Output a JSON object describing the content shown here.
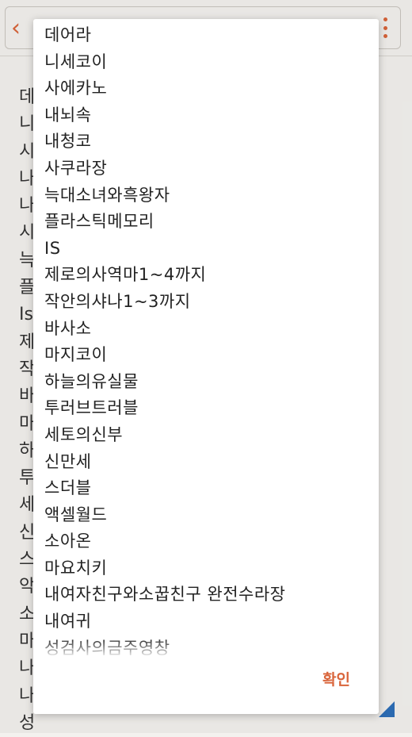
{
  "background": {
    "peek_lines": [
      "데",
      "니",
      "시",
      "나",
      "나",
      "시",
      "늑",
      "플",
      "Is",
      "제",
      "작",
      "바",
      "마",
      "하",
      "투",
      "세",
      "신",
      "스",
      "악",
      "소",
      "마",
      "나",
      "나",
      "성"
    ]
  },
  "dialog": {
    "items": [
      "데어라",
      "니세코이",
      "사에카노",
      "내뇌속",
      "내청코",
      "사쿠라장",
      "늑대소녀와흑왕자",
      "플라스틱메모리",
      "IS",
      "제로의사역마1~4까지",
      "작안의샤나1~3까지",
      "바사소",
      "마지코이",
      "하늘의유실물",
      "투러브트러블",
      "세토의신부",
      "신만세",
      "스더블",
      "액셀월드",
      "소아온",
      "마요치키",
      "내여자친구와소꿉친구 완전수라장",
      "내여귀",
      "성검사의금주영창"
    ],
    "confirm_label": "확인"
  },
  "colors": {
    "accent": "#d9643a",
    "corner": "#2d6fb8"
  }
}
